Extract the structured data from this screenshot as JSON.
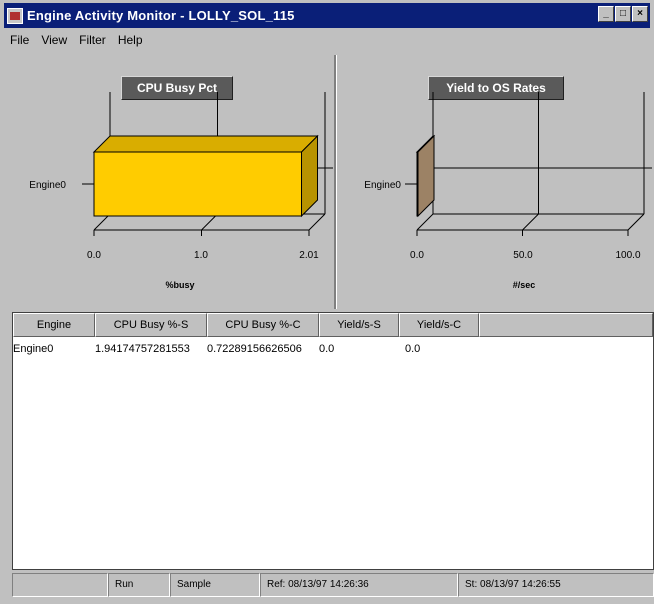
{
  "window": {
    "title": "Engine Activity Monitor - LOLLY_SOL_115",
    "buttons": [
      "_",
      "□",
      "×"
    ]
  },
  "menu": [
    "File",
    "View",
    "Filter",
    "Help"
  ],
  "charts": {
    "cpu": {
      "button_label": "CPU Busy Pct",
      "category_label": "Engine0",
      "tick_labels": [
        "0.0",
        "1.0",
        "2.01"
      ],
      "xlabel": "%busy"
    },
    "yield": {
      "button_label": "Yield to OS Rates",
      "category_label": "Engine0",
      "tick_labels": [
        "0.0",
        "50.0",
        "100.0"
      ],
      "xlabel": "#/sec"
    }
  },
  "chart_data": [
    {
      "type": "bar",
      "title": "CPU Busy Pct",
      "categories": [
        "Engine0"
      ],
      "values": [
        1.94
      ],
      "xlabel": "%busy",
      "xlim": [
        0,
        2.01
      ],
      "orientation": "horizontal",
      "color": "#ffcc00"
    },
    {
      "type": "bar",
      "title": "Yield to OS Rates",
      "categories": [
        "Engine0"
      ],
      "values": [
        0
      ],
      "xlabel": "#/sec",
      "xlim": [
        0,
        100
      ],
      "orientation": "horizontal",
      "color": "#d8b48c"
    }
  ],
  "table": {
    "columns": [
      "Engine",
      "CPU Busy %-S",
      "CPU Busy %-C",
      "Yield/s-S",
      "Yield/s-C"
    ],
    "rows": [
      [
        "Engine0",
        "1.94174757281553",
        "0.72289156626506",
        "0.0",
        "0.0"
      ]
    ]
  },
  "status": {
    "cells": [
      "",
      "Run",
      "Sample",
      "Ref: 08/13/97 14:26:36",
      "St: 08/13/97 14:26:55"
    ]
  }
}
